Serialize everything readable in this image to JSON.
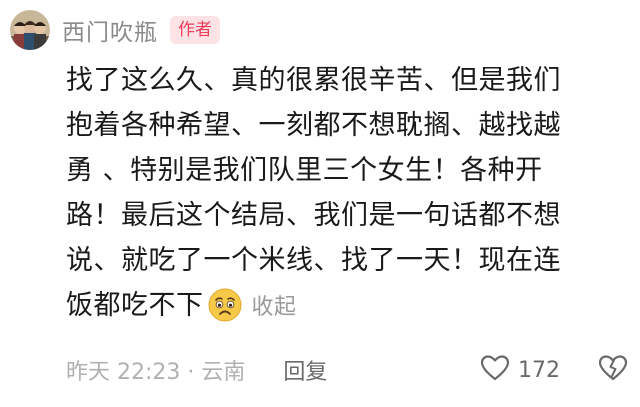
{
  "comment": {
    "username": "西门吹瓶",
    "badge": "作者",
    "lines": [
      "找了这么久、真的很累很辛苦、但是我们",
      "抱着各种希望、一刻都不想耽搁、越找越",
      "勇 、特别是我们队里三个女生！各种开",
      "路！最后这个结局、我们是一句话都不想",
      "说、就吃了一个米线、找了一天！现在连",
      "饭都吃不下"
    ],
    "emoji": "worried-face-icon",
    "collapse_label": "收起",
    "meta": "昨天 22:23 · 云南",
    "reply_label": "回复",
    "like_count": "172",
    "colors": {
      "badge_bg": "#fde3e6",
      "badge_text": "#ef3d5a",
      "body_text": "#1a1a1a",
      "muted": "#b0b0b0"
    }
  }
}
